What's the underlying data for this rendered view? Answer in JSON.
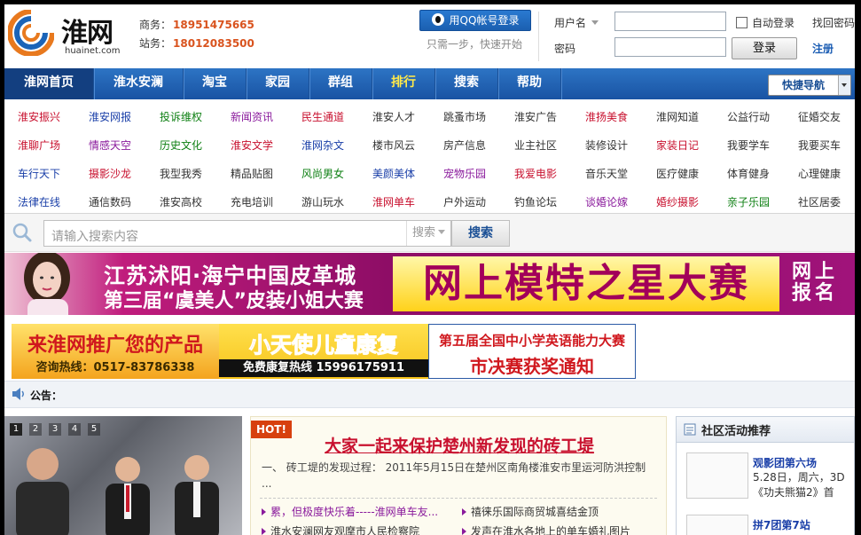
{
  "header": {
    "logo_name": "淮网",
    "logo_domain": "huainet.com",
    "contact_business_label": "商务：",
    "contact_business_number": "18951475665",
    "contact_station_label": "站务：",
    "contact_station_number": "18012083500",
    "qq_login_label": "用QQ帐号登录",
    "qq_tip": "只需一步，快速开始",
    "username_label": "用户名",
    "password_label": "密码",
    "auto_login_label": "自动登录",
    "forgot_password_label": "找回密码",
    "login_button": "登录",
    "register_link": "注册"
  },
  "nav": {
    "items": [
      {
        "label": "淮网首页"
      },
      {
        "label": "淮水安澜"
      },
      {
        "label": "淘宝"
      },
      {
        "label": "家园"
      },
      {
        "label": "群组"
      },
      {
        "label": "排行"
      },
      {
        "label": "搜索"
      },
      {
        "label": "帮助"
      }
    ],
    "quick_nav_label": "快捷导航"
  },
  "channels": {
    "rows": [
      [
        "淮安振兴",
        "淮安网报",
        "投诉维权",
        "新闻资讯",
        "民生通道",
        "淮安人才",
        "跳蚤市场",
        "淮安广告",
        "淮扬美食",
        "淮网知道",
        "公益行动",
        "征婚交友"
      ],
      [
        "淮聊广场",
        "情感天空",
        "历史文化",
        "淮安文学",
        "淮网杂文",
        "楼市风云",
        "房产信息",
        "业主社区",
        "装修设计",
        "家装日记",
        "我要学车",
        "我要买车"
      ],
      [
        "车行天下",
        "摄影沙龙",
        "我型我秀",
        "精品贴图",
        "风尚男女",
        "美颜美体",
        "宠物乐园",
        "我爱电影",
        "音乐天堂",
        "医疗健康",
        "体育健身",
        "心理健康"
      ],
      [
        "法律在线",
        "通信数码",
        "淮安高校",
        "充电培训",
        "游山玩水",
        "淮网单车",
        "户外运动",
        "钓鱼论坛",
        "谈婚论嫁",
        "婚纱摄影",
        "亲子乐园",
        "社区居委"
      ]
    ],
    "colors": [
      [
        "red",
        "blue",
        "green",
        "purple",
        "red",
        "gray",
        "gray",
        "gray",
        "red",
        "gray",
        "gray",
        "gray"
      ],
      [
        "red",
        "purple",
        "green",
        "red",
        "blue",
        "gray",
        "gray",
        "gray",
        "gray",
        "red",
        "gray",
        "gray"
      ],
      [
        "blue",
        "red",
        "gray",
        "gray",
        "green",
        "blue",
        "purple",
        "red",
        "gray",
        "gray",
        "gray",
        "gray"
      ],
      [
        "blue",
        "gray",
        "gray",
        "gray",
        "gray",
        "red",
        "gray",
        "gray",
        "purple",
        "red",
        "green",
        "gray"
      ]
    ]
  },
  "search": {
    "placeholder": "请输入搜索内容",
    "type_label": "搜索",
    "button": "搜索"
  },
  "banner_big": {
    "line1": "江苏沭阳·海宁中国皮革城",
    "line2": "第三届“虞美人”皮装小姐大赛",
    "headline": "网上模特之星大赛",
    "side_line1": "网上",
    "side_line2": "报名"
  },
  "ads": [
    {
      "line1": "来淮网推广您的产品",
      "line2": "咨询热线：0517-83786338"
    },
    {
      "line1": "小天使儿童康复",
      "line2": "免费康复热线 15996175911"
    },
    {
      "line1": "第五届全国中小学英语能力大赛",
      "line2": "市决赛获奖通知"
    }
  ],
  "announcement": {
    "label": "公告："
  },
  "slider": {
    "pages": [
      "1",
      "2",
      "3",
      "4",
      "5"
    ],
    "active_page": "1"
  },
  "news": {
    "hot_tag": "HOT!",
    "headline": "大家一起来保护楚州新发现的砖工堤",
    "summary": "一、 砖工堤的发现过程： 2011年5月15日在楚州区南角楼淮安市里运河防洪控制 ...",
    "items": [
      {
        "text": "累，但极度快乐着-----淮网单车友...",
        "color": "#8a1a9c"
      },
      {
        "text": "禧徕乐国际商贸城喜结金顶",
        "color": "#333333"
      },
      {
        "text": "淮水安澜网友观摩市人民检察院",
        "color": "#333333"
      },
      {
        "text": "发声在淮水各地上的单车婚礼图片",
        "color": "#333333"
      }
    ]
  },
  "activity": {
    "title": "社区活动推荐",
    "items": [
      {
        "name": "观影团第六场",
        "desc": "5.28日，周六，3D《功夫熊猫2》首"
      },
      {
        "name": "拼7团第7站",
        "desc": ""
      }
    ]
  }
}
